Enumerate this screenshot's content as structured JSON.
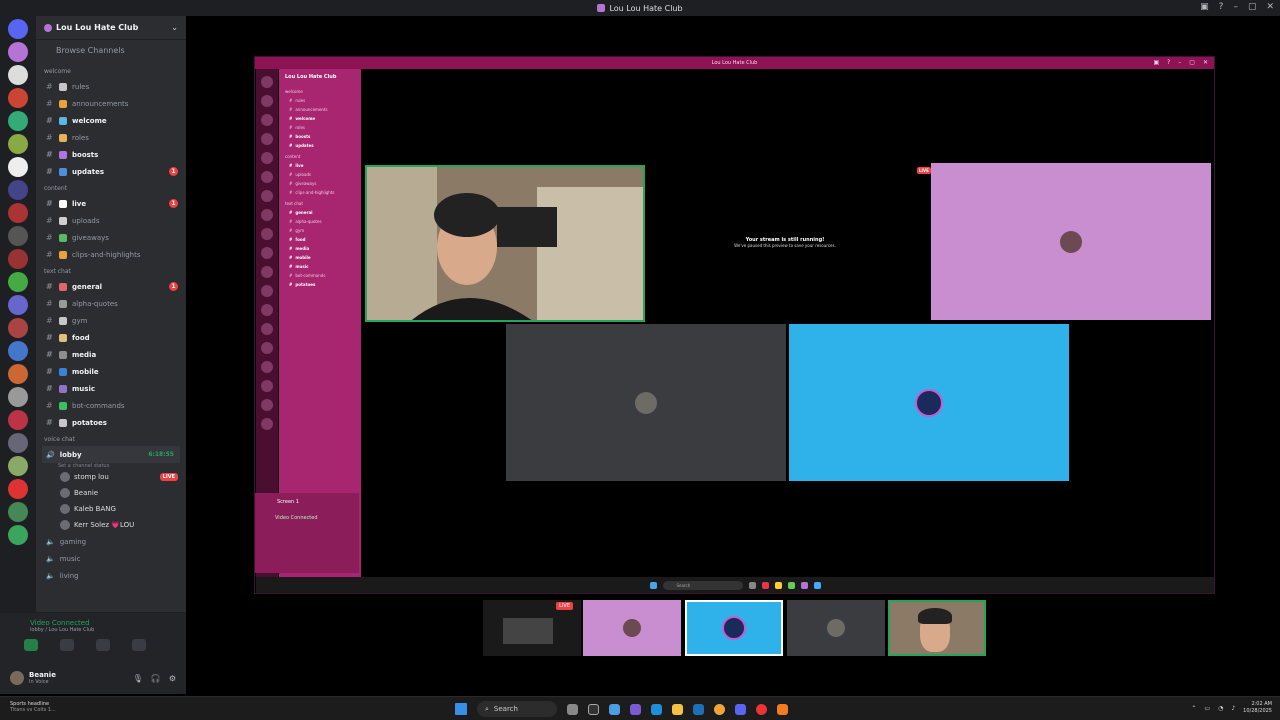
{
  "window": {
    "title": "Lou Lou Hate Club"
  },
  "server": {
    "name": "Lou Lou Hate Club",
    "browse": "Browse Channels"
  },
  "categories": [
    {
      "name": "welcome",
      "channels": [
        {
          "label": "rules",
          "bold": false,
          "color": "#c7c7c7"
        },
        {
          "label": "announcements",
          "bold": false,
          "color": "#e7a23a"
        },
        {
          "label": "welcome",
          "bold": true,
          "color": "#5fb6e0"
        },
        {
          "label": "roles",
          "bold": false,
          "color": "#e8b357"
        },
        {
          "label": "boosts",
          "bold": true,
          "color": "#b275e0"
        },
        {
          "label": "updates",
          "bold": true,
          "color": "#4d8fdc",
          "badge": "1"
        }
      ]
    },
    {
      "name": "content",
      "channels": [
        {
          "label": "live",
          "bold": true,
          "color": "#ffffff",
          "badge": "1"
        },
        {
          "label": "uploads",
          "bold": false,
          "color": "#d0d0d0"
        },
        {
          "label": "giveaways",
          "bold": false,
          "color": "#5aba62"
        },
        {
          "label": "clips-and-highlights",
          "bold": false,
          "color": "#e8a23a"
        }
      ]
    },
    {
      "name": "text chat",
      "channels": [
        {
          "label": "general",
          "bold": true,
          "color": "#e06868",
          "badge": "1"
        },
        {
          "label": "alpha-quotes",
          "bold": false,
          "color": "#9a9a9a"
        },
        {
          "label": "gym",
          "bold": false,
          "color": "#c7c7c7"
        },
        {
          "label": "food",
          "bold": true,
          "color": "#e0c07a"
        },
        {
          "label": "media",
          "bold": true,
          "color": "#8e8e8e"
        },
        {
          "label": "mobile",
          "bold": true,
          "color": "#3a82d8"
        },
        {
          "label": "music",
          "bold": true,
          "color": "#8f73c8"
        },
        {
          "label": "bot-commands",
          "bold": false,
          "color": "#3ac060"
        },
        {
          "label": "potatoes",
          "bold": true,
          "color": "#c7c7c7"
        }
      ]
    }
  ],
  "voice": {
    "category": "voice chat",
    "lobby": "lobby",
    "lobby_time": "6:18:55",
    "status_placeholder": "Set a channel status",
    "users": [
      {
        "name": "stomp lou",
        "live": "LIVE"
      },
      {
        "name": "Beanie"
      },
      {
        "name": "Kaleb BANG"
      },
      {
        "name": "Kerr Solez 💗LOU"
      }
    ],
    "others": [
      "gaming",
      "music",
      "living"
    ]
  },
  "video_connected": {
    "status": "Video Connected",
    "detail": "lobby / Lou Lou Hate Club"
  },
  "user": {
    "name": "Beanie",
    "status": "In Voice"
  },
  "share": {
    "title": "Lou Lou Hate Club",
    "notice_title": "Your stream is still running!",
    "notice_body": "We've paused this preview to save your resources.",
    "live": "LIVE",
    "screen_label": "Screen 1",
    "vc": "Video Connected",
    "search": "Search"
  },
  "colors": {
    "pink_tile": "#c98ed0",
    "blue_tile": "#2fb2ea",
    "gray_tile": "#3a3c3f"
  },
  "thumb_live": "LIVE",
  "taskbar": {
    "weather_title": "Sports headline",
    "weather_sub": "Titans vs Colts 1...",
    "search": "Search",
    "time": "2:02 AM",
    "date": "10/28/2025"
  }
}
